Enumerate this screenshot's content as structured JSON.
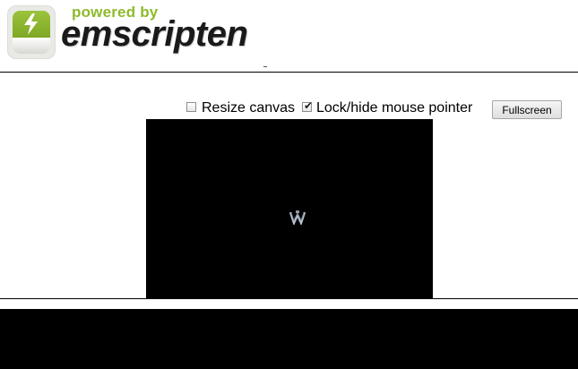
{
  "header": {
    "tagline": "powered by",
    "brand": "emscripten",
    "accent_color": "#8dbb2a",
    "logo_icon": "lightning-bolt-icon"
  },
  "controls": {
    "resize_canvas": {
      "label": "Resize canvas",
      "checked": false
    },
    "lock_pointer": {
      "label": "Lock/hide mouse pointer",
      "checked": true
    },
    "fullscreen_label": "Fullscreen"
  },
  "canvas": {
    "background": "#000000",
    "sprite_icon": "game-sprite-icon"
  },
  "output": {
    "background": "#000000"
  }
}
